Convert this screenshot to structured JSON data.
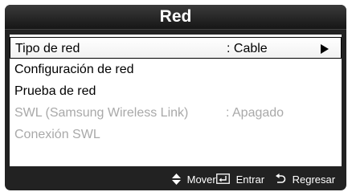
{
  "window": {
    "title": "Red"
  },
  "menu": {
    "items": [
      {
        "label": "Tipo de red",
        "value": ": Cable",
        "state": "selected"
      },
      {
        "label": "Configuración de red",
        "state": "enabled"
      },
      {
        "label": "Prueba de red",
        "state": "enabled"
      },
      {
        "label": "SWL (Samsung Wireless Link)",
        "value": ": Apagado",
        "state": "disabled"
      },
      {
        "label": "Conexión SWL",
        "state": "disabled"
      }
    ]
  },
  "footer": {
    "move": "Mover",
    "enter": "Entrar",
    "back": "Regresar"
  },
  "icons": {
    "submenu_arrow": "play-arrow-icon",
    "move": "up-down-arrows-icon",
    "enter": "enter-key-icon",
    "back": "return-arrow-icon"
  },
  "colors": {
    "frame": "#222222",
    "title_text": "#ffffff",
    "panel": "#ffffff",
    "disabled_text": "#a9a9a9"
  }
}
